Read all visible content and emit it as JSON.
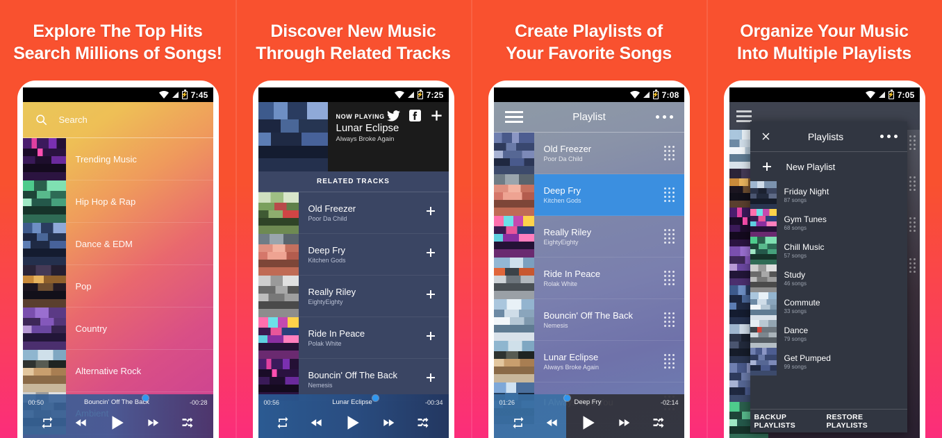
{
  "background": {
    "top_color": "#F9512F",
    "bottom_color": "#FB2D7B"
  },
  "panels": [
    {
      "headline_line1": "Explore The Top Hits",
      "headline_line2": "Search Millions of Songs!",
      "status_time": "7:45",
      "search": {
        "placeholder": "Search",
        "icon": "search-icon"
      },
      "categories": [
        "Trending Music",
        "Hip Hop & Rap",
        "Dance & EDM",
        "Pop",
        "Country",
        "Alternative Rock",
        "Ambient"
      ],
      "player": {
        "elapsed": "00:50",
        "track": "Bouncin' Off The Back",
        "remaining": "-00:28",
        "progress_pct": 64,
        "controls": [
          "repeat-icon",
          "previous-icon",
          "play-icon",
          "next-icon",
          "shuffle-icon"
        ]
      }
    },
    {
      "headline_line1": "Discover New Music",
      "headline_line2": "Through Related Tracks",
      "status_time": "7:25",
      "now_playing": {
        "label": "NOW PLAYING",
        "title": "Lunar Eclipse",
        "artist": "Always Broke Again",
        "actions": [
          "twitter-icon",
          "facebook-icon",
          "add-icon"
        ]
      },
      "section_header": "RELATED TRACKS",
      "tracks": [
        {
          "title": "Old Freezer",
          "artist": "Poor Da Child",
          "action": "add-icon"
        },
        {
          "title": "Deep Fry",
          "artist": "Kitchen Gods",
          "action": "add-icon"
        },
        {
          "title": "Really Riley",
          "artist": "EightyEighty",
          "action": "add-icon"
        },
        {
          "title": "Ride In Peace",
          "artist": "Polak White",
          "action": "add-icon"
        },
        {
          "title": "Bouncin' Off The Back",
          "artist": "Nemesis",
          "action": "add-icon"
        }
      ],
      "player": {
        "elapsed": "00:56",
        "track": "Lunar Eclipse",
        "remaining": "-00:34",
        "progress_pct": 61,
        "controls": [
          "repeat-icon",
          "previous-icon",
          "play-icon",
          "next-icon",
          "shuffle-icon"
        ]
      }
    },
    {
      "headline_line1": "Create Playlists of",
      "headline_line2": "Your Favorite Songs",
      "status_time": "7:08",
      "appbar": {
        "menu_icon": "hamburger-icon",
        "title": "Playlist",
        "overflow_icon": "more-options-icon"
      },
      "selected_index": 1,
      "tracks": [
        {
          "title": "Old Freezer",
          "artist": "Poor Da Child"
        },
        {
          "title": "Deep Fry",
          "artist": "Kitchen Gods"
        },
        {
          "title": "Really Riley",
          "artist": "EightyEighty"
        },
        {
          "title": "Ride In Peace",
          "artist": "Rolak White"
        },
        {
          "title": "Bouncin' Off The Back",
          "artist": "Nemesis"
        },
        {
          "title": "Lunar Eclipse",
          "artist": "Always Broke Again"
        },
        {
          "title": "I Always Told You",
          "artist": ""
        }
      ],
      "player": {
        "elapsed": "01:26",
        "track": "Deep Fry",
        "remaining": "-02:14",
        "progress_pct": 39,
        "controls": [
          "repeat-icon",
          "previous-icon",
          "play-icon",
          "next-icon",
          "shuffle-icon"
        ]
      }
    },
    {
      "headline_line1": "Organize Your Music",
      "headline_line2": "Into Multiple Playlists",
      "status_time": "7:05",
      "modal": {
        "close_icon": "close-icon",
        "title": "Playlists",
        "overflow_icon": "more-options-icon",
        "new_playlist_label": "New Playlist",
        "new_playlist_icon": "add-icon",
        "playlists": [
          {
            "name": "Friday Night",
            "count": "87 songs"
          },
          {
            "name": "Gym Tunes",
            "count": "68 songs"
          },
          {
            "name": "Chill Music",
            "count": "57 songs"
          },
          {
            "name": "Study",
            "count": "46 songs"
          },
          {
            "name": "Commute",
            "count": "33 songs"
          },
          {
            "name": "Dance",
            "count": "79 songs"
          },
          {
            "name": "Get Pumped",
            "count": "99 songs"
          }
        ],
        "footer": {
          "backup_label": "BACKUP PLAYLISTS",
          "restore_label": "RESTORE PLAYLISTS"
        }
      }
    }
  ]
}
